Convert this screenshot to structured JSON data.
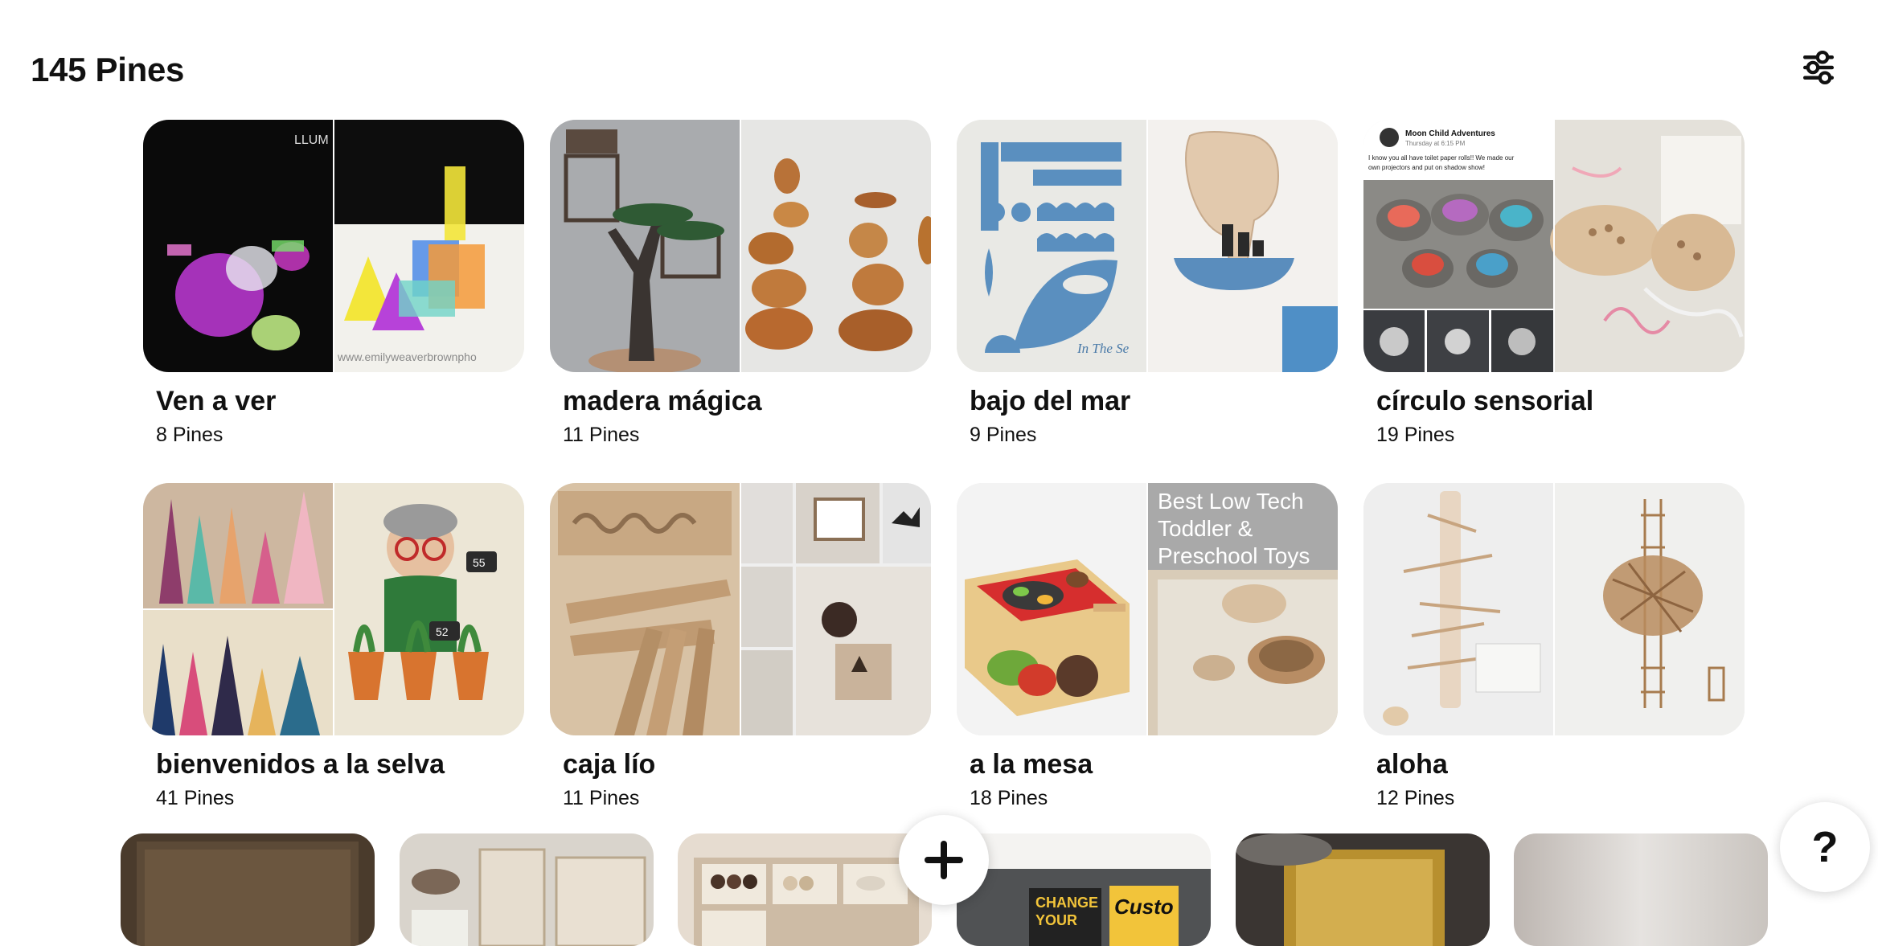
{
  "header": {
    "title": "145 Pines",
    "filter_icon": "sliders-icon"
  },
  "boards": [
    {
      "name": "Ven a ver",
      "count": "8 Pines"
    },
    {
      "name": "madera mágica",
      "count": "11 Pines"
    },
    {
      "name": "bajo del mar",
      "count": "9 Pines"
    },
    {
      "name": "círculo sensorial",
      "count": "19 Pines"
    },
    {
      "name": "bienvenidos a la selva",
      "count": "41 Pines"
    },
    {
      "name": "caja lío",
      "count": "11 Pines"
    },
    {
      "name": "a la mesa",
      "count": "18 Pines"
    },
    {
      "name": "aloha",
      "count": "12 Pines"
    }
  ],
  "cover_text": {
    "ven_watermark": "www.emilyweaverbrownpho",
    "ven_sign": "LLUM",
    "bajo_caption": "In The Se",
    "circulo_post_author": "Moon Child Adventures",
    "circulo_post_time": "Thursday at 6:15 PM",
    "circulo_post_text_1": "I know you all have toilet paper rolls!! We made our",
    "circulo_post_text_2": "own projectors and put on shadow show!",
    "mesa_overlay_1": "Best Low Tech",
    "mesa_overlay_2": "Toddler &",
    "mesa_overlay_3": "Preschool Toys",
    "selva_tag_1": "55",
    "selva_tag_2": "52",
    "bottom_sign_1": "CHANGE",
    "bottom_sign_2": "YOUR",
    "bottom_sign_3": "Custo"
  },
  "fab": {
    "create_icon": "plus-icon",
    "help_label": "?"
  },
  "colors": {
    "text": "#111111",
    "background": "#ffffff",
    "card_bg": "#ececec"
  }
}
